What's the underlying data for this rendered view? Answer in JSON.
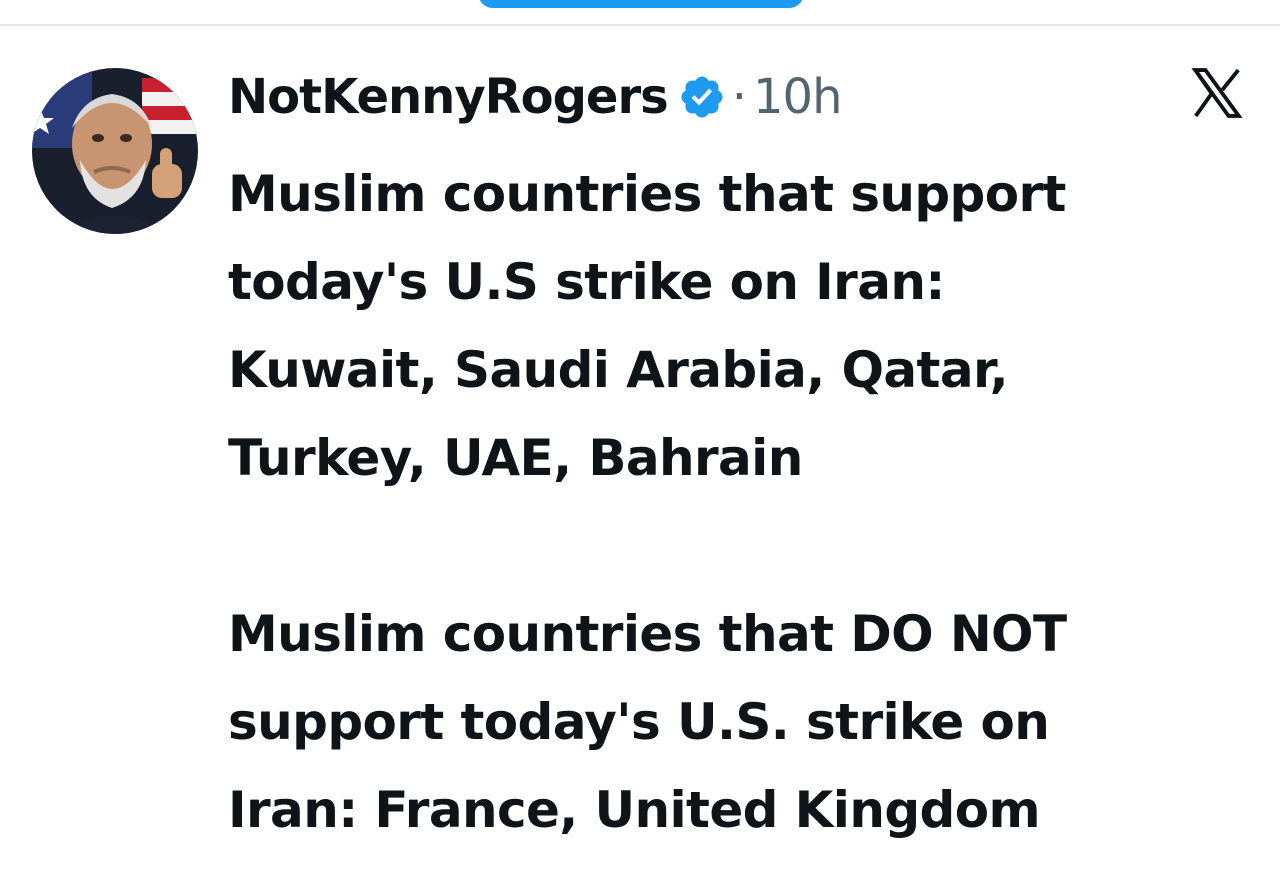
{
  "tweet": {
    "author_name": "NotKennyRogers",
    "verified_icon": "verified-badge-icon",
    "separator": "·",
    "time": "10h",
    "platform_icon": "x-logo-icon",
    "avatar_icon": "profile-avatar",
    "paragraphs": [
      "Muslim countries that support\ntoday's U.S strike on Iran:\nKuwait, Saudi Arabia, Qatar,\nTurkey, UAE, Bahrain",
      "Muslim countries that DO NOT\nsupport today's U.S. strike on\nIran: France, United Kingdom"
    ]
  },
  "colors": {
    "verified_blue": "#1d9bf0",
    "secondary_text": "#536471",
    "primary_text": "#0f1419"
  }
}
